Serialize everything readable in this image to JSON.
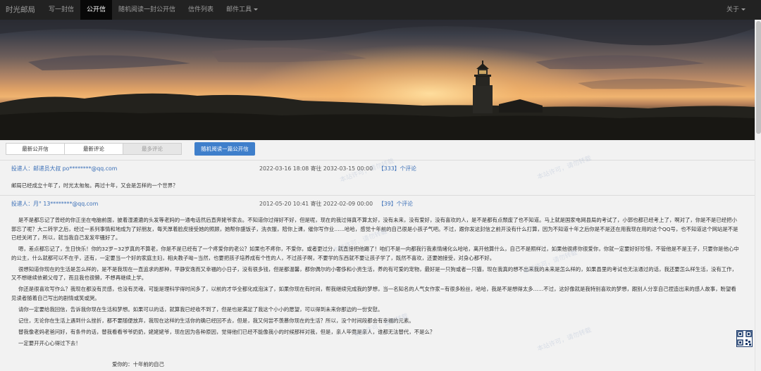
{
  "nav": {
    "brand": "时光邮局",
    "items": [
      {
        "label": "写一封信"
      },
      {
        "label": "公开信"
      },
      {
        "label": "随机阅读一封公开信"
      },
      {
        "label": "信件列表"
      },
      {
        "label": "邮件工具"
      }
    ],
    "active_index": 1,
    "about": "关于"
  },
  "tabs": [
    {
      "label": "最新公开信"
    },
    {
      "label": "最新评论"
    },
    {
      "label": "最多评论"
    }
  ],
  "random_button": "随机阅读一篇公开信",
  "letters": [
    {
      "author": "投递人：邮递员大叔 po********@qq.com",
      "meta": "2022-03-16 18:08 寄往 2032-03-15 00:00",
      "comments": "【333】个评论",
      "body": [
        "邮局已经成立十年了，时光太匆匆。再过十年，又会是怎样的一个世界？"
      ]
    },
    {
      "author": "投递人：月° 13********@qq.com",
      "meta": "2012-05-20 10:41 寄往 2022-02-09 00:00",
      "comments": "【39】个评论",
      "body": [
        "是不是都忘记了曾经的你正坐在电脑前面，披着湿漉漉的头发等老妈的一通电话然后直奔姥爷家去。不知道你过得好不好，但是呢，现在的我过得真不算太好，没有未来，没有爱好，没有喜欢的人，是不是都有点颓废了也不知道。马上就是国家电网县局的考试了，小郭也都已经考上了，啊对了，你是不是已经把小郭忘了呢？大二转学之后，经过一系列事情和地成为了好朋友，每天厚着脸皮接受她的照顾，她帮你盛饭子，洗衣服，陪你上课，催你写作业……哈哈，感觉十年前的自己很是小孩子气吧。不过，跟你发这封信之前开没有什么打算，因为不知道十年之后你是不是还在用我现在用的这个QQ号，也不知道这个网站是不是已经关闭了，所以，就当我自己发发牢骚好了。",
        "嗯，差点都忘记了，生日快乐！你的32岁~32岁真的不算老，你是不是已经有了一个疼爱你的老公？如果也不疼你，不爱你，或者更过分，就直接把他踢了！咱们不是一向都我行我素情绪化么哈哈，离开他算什么，自己不是照样过，如果他很疼你很爱你，你就一定要好好珍惜，不管他是不是王子，只要你是他心中的公主，什么就都可以不在乎，还有，一定要当一个好的家庭主妇，相夫教子呦~当然，也要把孩子培养成有个性的人，不过孩子啊，不要学的东西就不要让孩子学了，既然不喜欢，还要她接受，对身心都不好。",
        "很想知道你现在的生活是怎么样的，是不是我现在一直追求的那种，平静安逸而又幸福的小日子，没有很多钱，但是都温馨，都你偶尔的小奢侈和小资生活，养的有可爱的宠物，最好是一只狗或者一只猫，现在我真的想不出来我的未来是怎么样的，如果县里的考试也无法通过的话，我还要怎么样生活，没有工作，又不想继续依赖父母了，而且我也很懒，不想再继续上学。",
        "你还是很喜欢写作么？我现在都没有灵感，也没有灵魂，可能是理科学得时间多了，以前的才华全都化成泡沫了，如果你现在有时间，帮我继续完成我的梦想，当一名知名的人气女作家~有很多粉丝，哈哈，我是不是想得太多……不过，这好像就是我特别喜欢的梦想，跟别人分享自己捏造出来的感人故事，盼望看见读者随着自己写出的剧情或笑或哭。",
        "请你一定要给我回信，告诉我你现在生活和梦想。如果可以的话，就算我已经收不到了，但是也是满足了我这个小小的愿望，可以得到未来你那边的一份安慰。",
        "记住，无论你在生活上遇到什么挫折，都不要随便放弃，我现在这样的生活你的确已经回不去，但是，我又何尝不羡慕你现在的生活？所以，没个时间段都会有幸福的元素。",
        "替我像老妈老爸问好，有条件的话，替我看看爷爷奶奶，姥姥姥爷，现在因为各种原因，觉得他们已经不能像我小的时候那样对我，但是，亲人毕竟是亲人，谁都无法替代，不是么？",
        "一定要开开心心得过下去！"
      ],
      "signature": "爱你的：十年前的自己"
    }
  ],
  "watermark": "本站许可，请勿转载"
}
